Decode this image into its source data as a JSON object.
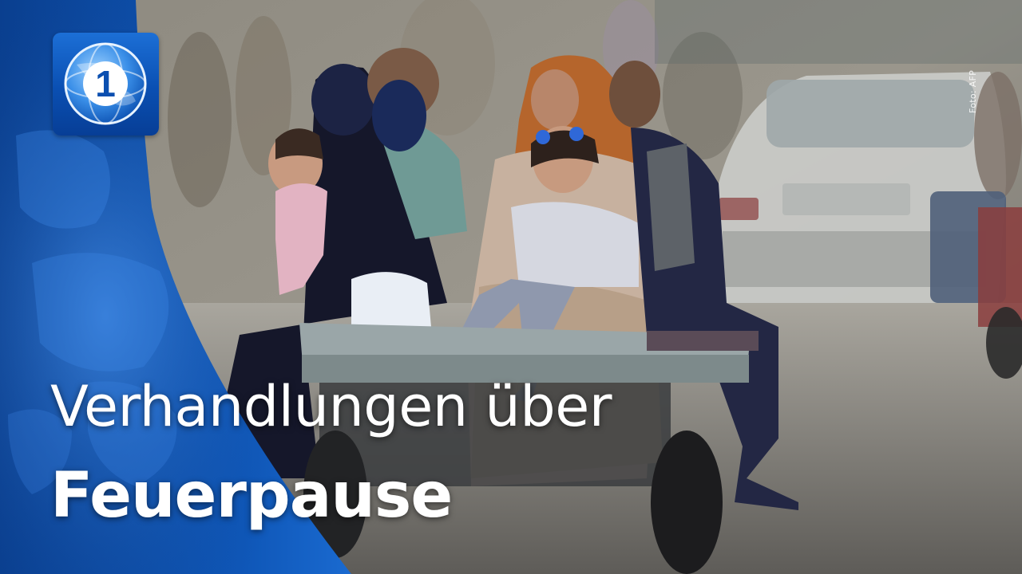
{
  "headline": {
    "line1": "Verhandlungen über",
    "line2": "Feuerpause"
  },
  "photo": {
    "credit": "Foto: AFP"
  },
  "logo": {
    "icon": "tagesschau-globe-one-logo-icon",
    "digit": "1"
  },
  "colors": {
    "brand_blue": "#0a4fb2",
    "panel_blue": "#0b3f8c",
    "text": "#ffffff"
  }
}
